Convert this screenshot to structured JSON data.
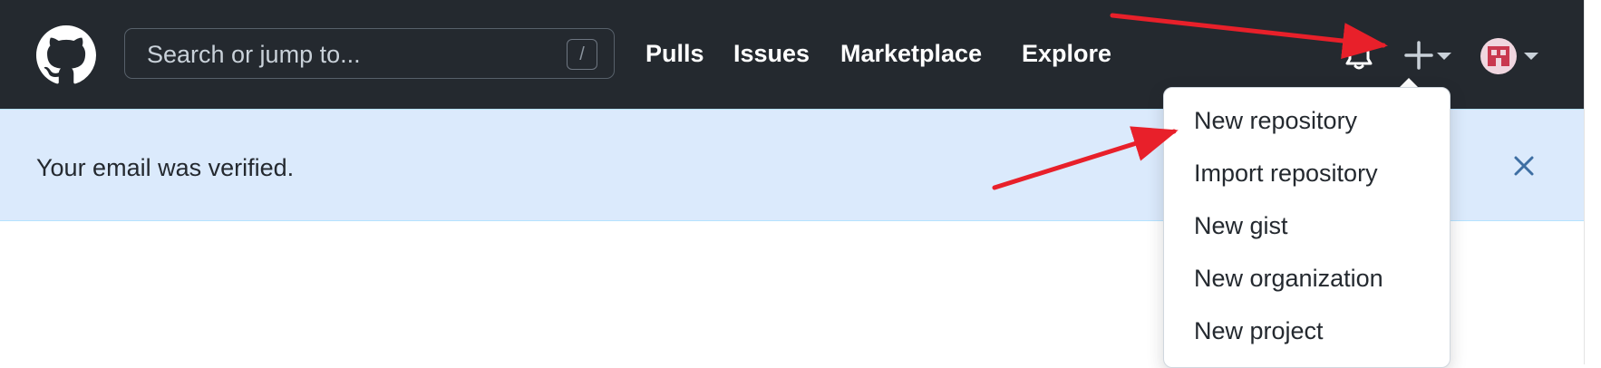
{
  "header": {
    "search": {
      "placeholder": "Search or jump to...",
      "shortcut_key": "/"
    },
    "nav": [
      "Pulls",
      "Issues",
      "Marketplace",
      "Explore"
    ],
    "icons": {
      "logo": "github-logo-icon",
      "notifications": "bell-icon",
      "create": "plus-icon",
      "avatar": "avatar"
    }
  },
  "banner": {
    "message": "Your email was verified.",
    "close_icon": "close-icon"
  },
  "create_menu": {
    "items": [
      "New repository",
      "Import repository",
      "New gist",
      "New organization",
      "New project"
    ]
  },
  "colors": {
    "header_bg": "#24292f",
    "banner_bg": "#dbeafc",
    "annotation_arrow": "#e8202a"
  }
}
